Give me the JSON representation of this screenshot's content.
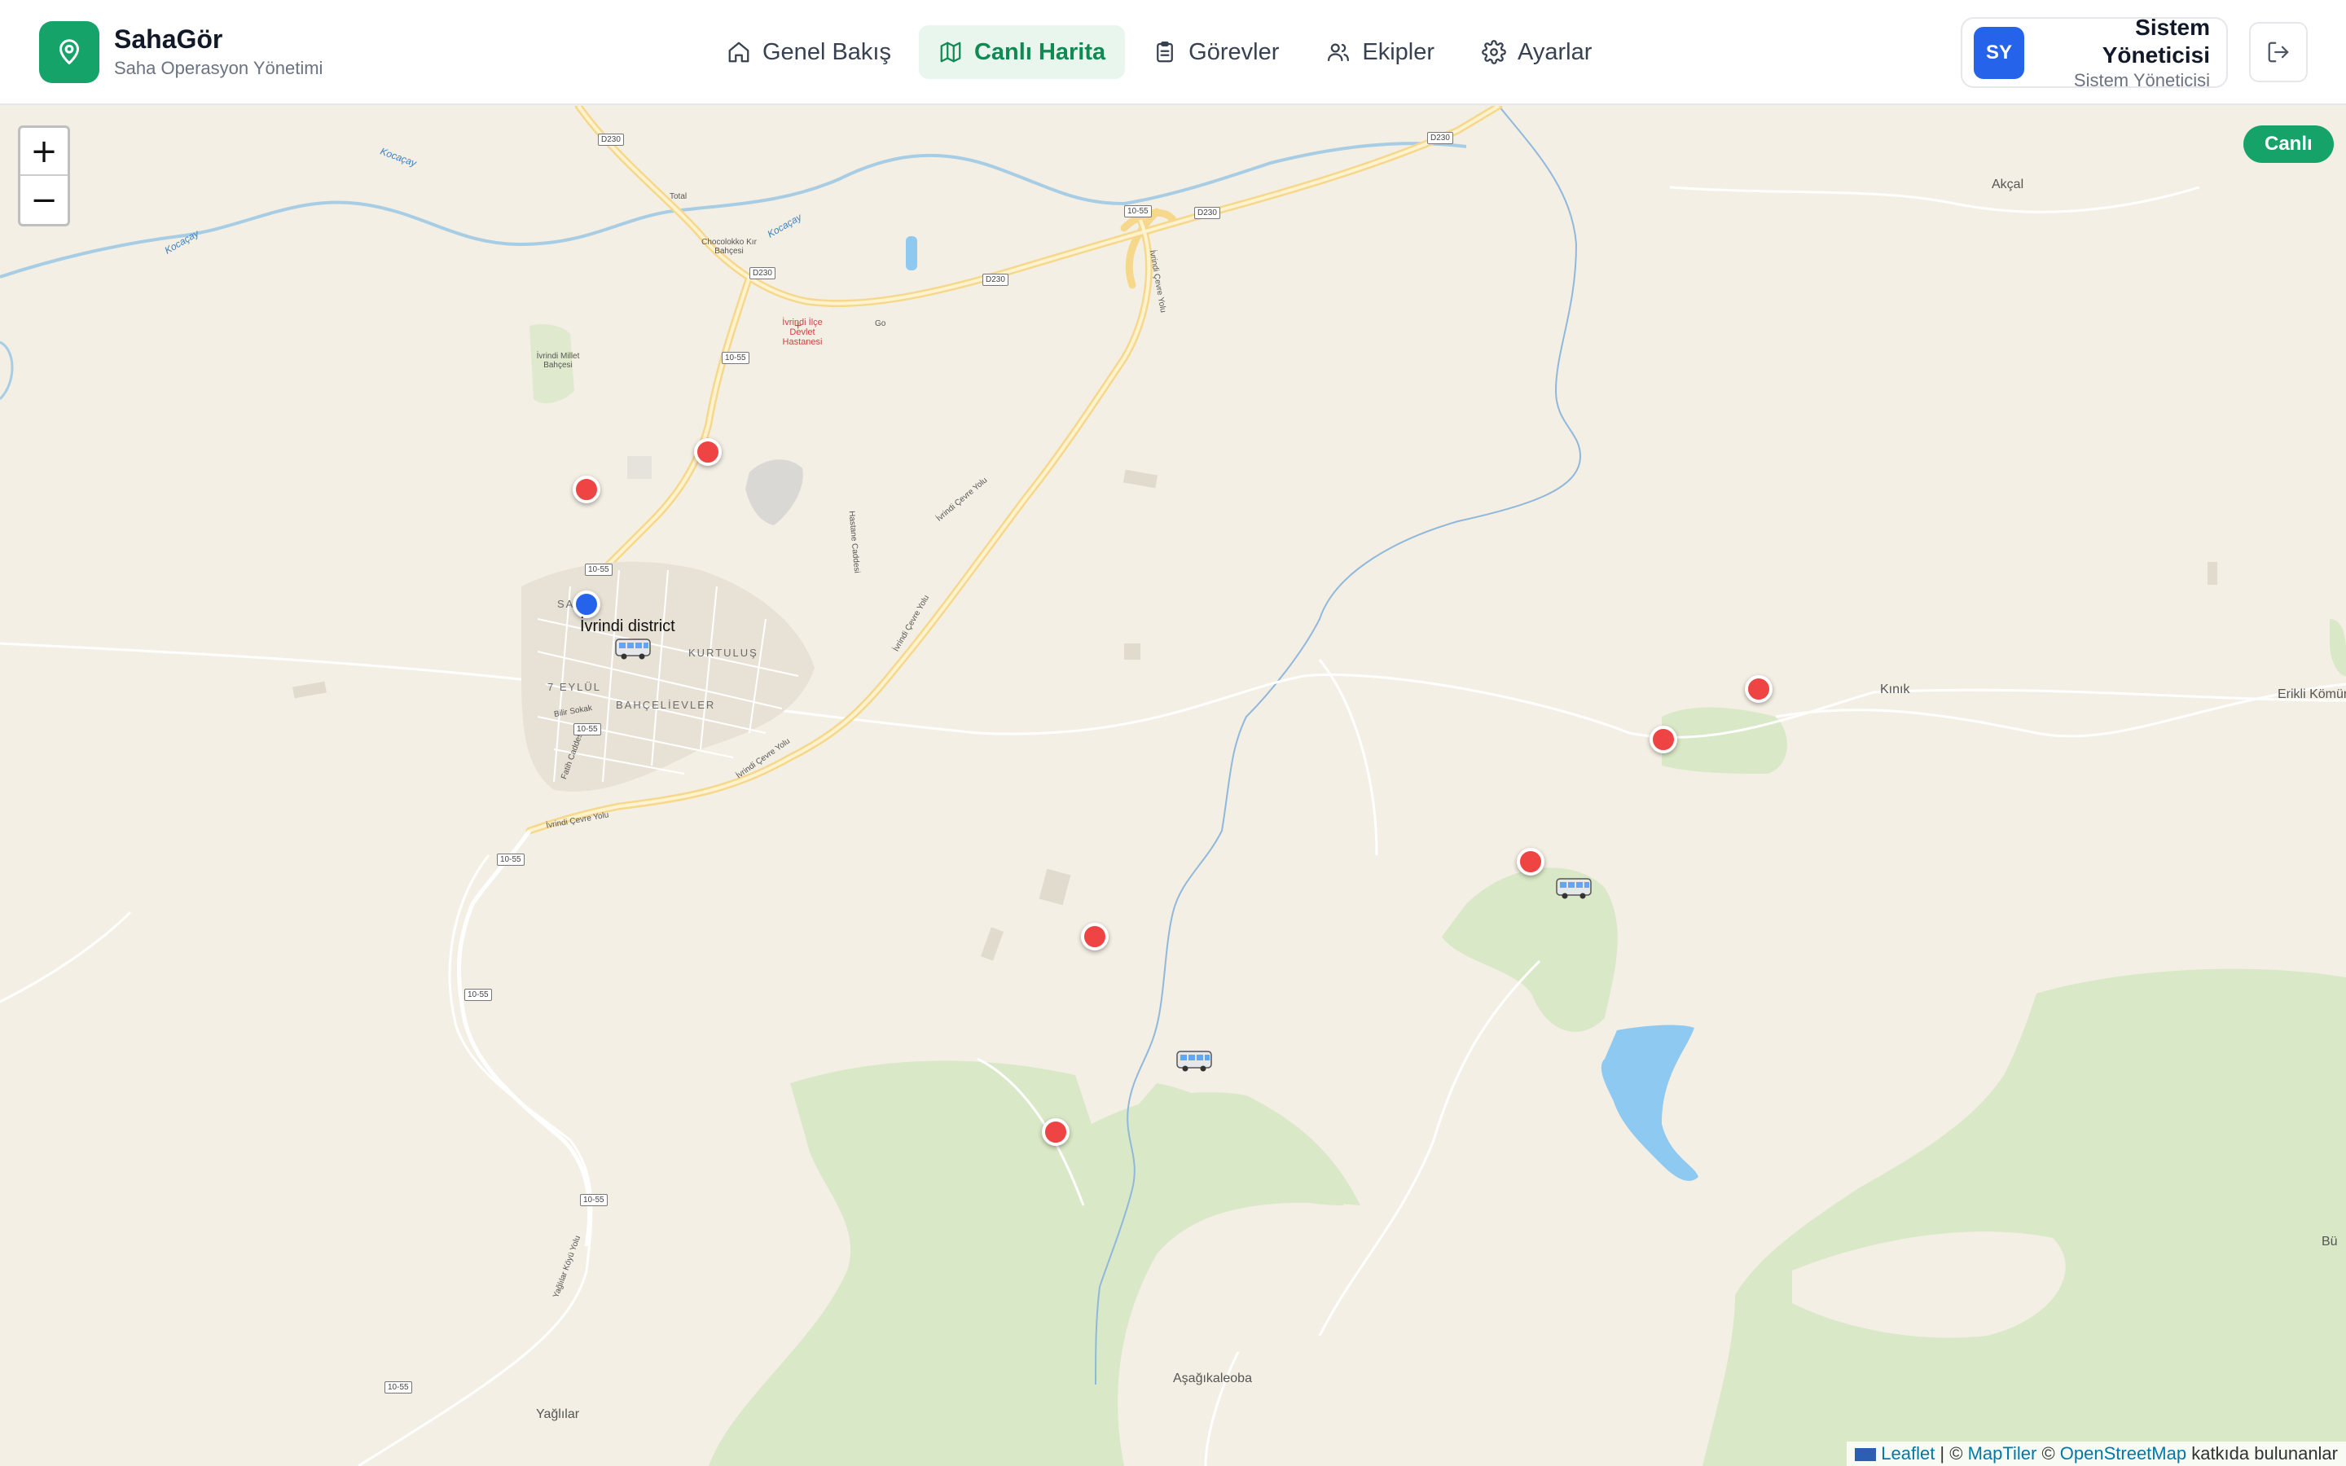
{
  "brand": {
    "name": "SahaGör",
    "subtitle": "Saha Operasyon Yönetimi",
    "logo_icon": "map-pin-icon",
    "color": "#16a36a"
  },
  "nav": {
    "items": [
      {
        "label": "Genel Bakış",
        "icon": "home-icon",
        "active": false
      },
      {
        "label": "Canlı Harita",
        "icon": "map-icon",
        "active": true
      },
      {
        "label": "Görevler",
        "icon": "clipboard-icon",
        "active": false
      },
      {
        "label": "Ekipler",
        "icon": "users-icon",
        "active": false
      },
      {
        "label": "Ayarlar",
        "icon": "gear-icon",
        "active": false
      }
    ],
    "active_color": "#0f8a52"
  },
  "user": {
    "initials": "SY",
    "name": "Sistem Yöneticisi",
    "role": "Sistem Yöneticisi",
    "avatar_color": "#2563eb"
  },
  "map": {
    "zoom_in": "+",
    "zoom_out": "−",
    "live_label": "Canlı",
    "district_label": "İvrindi district",
    "labels": {
      "akcal": "Akçal",
      "kinik": "Kınık",
      "erikli": "Erikli Kömürc",
      "asagikaleoba": "Aşağıkaleoba",
      "yaglilar": "Yağlılar",
      "kurtulus": "KURTULUŞ",
      "yedi_eylul": "7 EYLÜL",
      "bahcelievler": "BAHÇELİEVLER",
      "sa_ya": "SA     YA",
      "kocacay1": "Kocaçay",
      "kocacay2": "Kocaçay",
      "kocacay3": "Kocaçay",
      "millet": "İvrindi Millet Bahçesi",
      "hastane": "İvrindi İlçe Devlet Hastanesi",
      "chocolokko": "Chocolokko Kır Bahçesi",
      "total": "Total",
      "go": "Go",
      "cevre1": "İvrindi Çevre Yolu",
      "cevre2": "İvrindi Çevre Yolu",
      "cevre3": "İvrindi Çevre Yolu",
      "cevre4": "İvrindi Çevre Yolu",
      "cevre5": "İvrindi Çevre Yolu",
      "fatih": "Fatih Caddesi",
      "bilir": "Bilir Sokak",
      "hastane_cad": "Hastane Caddesi",
      "yaglilar_yolu": "Yağlılar Köyü Yolu",
      "bu": "Bü"
    },
    "shields": [
      "D230",
      "D230",
      "D230",
      "D230",
      "10-55",
      "D230",
      "10-55",
      "10-55",
      "10-55",
      "10-55",
      "10-55",
      "10-55",
      "10-55"
    ],
    "attribution": {
      "leaflet": "Leaflet",
      "sep1": " | © ",
      "maptiler": "MapTiler",
      "sep2": " © ",
      "osm": "OpenStreetMap",
      "tail": " katkıda bulunanlar"
    }
  }
}
